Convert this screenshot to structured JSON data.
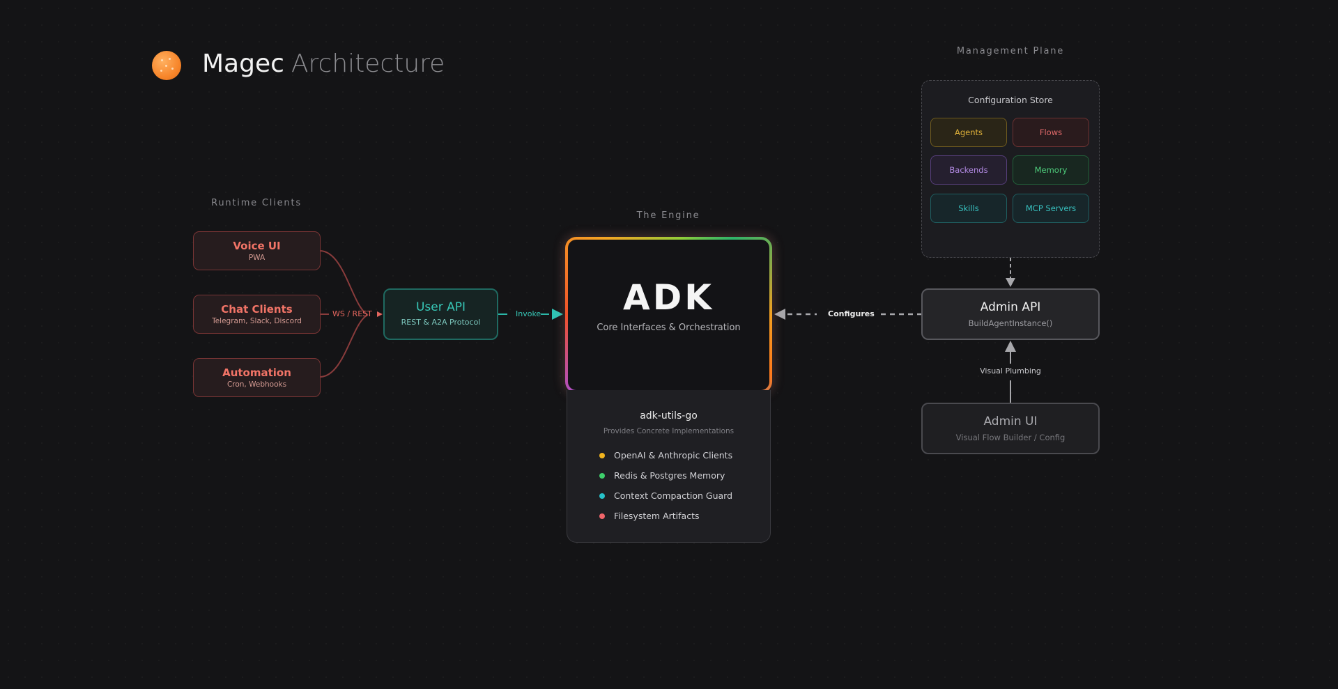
{
  "header": {
    "title_primary": "Magec",
    "title_secondary": "Architecture"
  },
  "sections": {
    "runtime_clients": "Runtime Clients",
    "engine": "The Engine",
    "management_plane": "Management Plane"
  },
  "clients": [
    {
      "name": "Voice UI",
      "sub": "PWA"
    },
    {
      "name": "Chat Clients",
      "sub": "Telegram, Slack, Discord"
    },
    {
      "name": "Automation",
      "sub": "Cron, Webhooks"
    }
  ],
  "edges": {
    "ws_rest": "WS / REST",
    "invoke": "Invoke",
    "configures": "Configures",
    "visual_plumbing": "Visual Plumbing"
  },
  "user_api": {
    "name": "User API",
    "sub": "REST & A2A Protocol"
  },
  "engine": {
    "title": "ADK",
    "subtitle": "Core Interfaces & Orchestration"
  },
  "utils": {
    "title": "adk-utils-go",
    "subtitle": "Provides Concrete Implementations",
    "items": [
      {
        "label": "OpenAI & Anthropic Clients",
        "color": "#f2b41e"
      },
      {
        "label": "Redis & Postgres Memory",
        "color": "#3ecf6b"
      },
      {
        "label": "Context Compaction Guard",
        "color": "#27c2c9"
      },
      {
        "label": "Filesystem Artifacts",
        "color": "#f0656a"
      }
    ]
  },
  "config_store": {
    "title": "Configuration Store",
    "chips": [
      {
        "label": "Agents",
        "color": "#e0b23a"
      },
      {
        "label": "Flows",
        "color": "#e26a6a"
      },
      {
        "label": "Backends",
        "color": "#b48be6"
      },
      {
        "label": "Memory",
        "color": "#4fcf7d"
      },
      {
        "label": "Skills",
        "color": "#38c2c0"
      },
      {
        "label": "MCP Servers",
        "color": "#38c2c0"
      }
    ]
  },
  "admin_api": {
    "name": "Admin API",
    "sub": "BuildAgentInstance()"
  },
  "admin_ui": {
    "name": "Admin UI",
    "sub": "Visual Flow Builder / Config"
  }
}
